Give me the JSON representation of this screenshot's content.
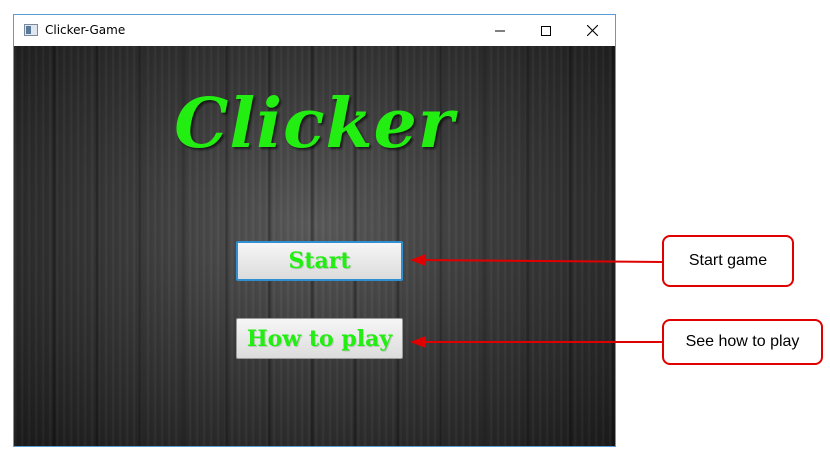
{
  "window": {
    "title": "Clicker-Game",
    "controls": {
      "minimize": "—",
      "maximize": "☐",
      "close": "✕"
    }
  },
  "game": {
    "logo": "Clicker",
    "start_label": "Start",
    "how_to_play_label": "How to play"
  },
  "annotations": {
    "start_callout": "Start game",
    "how_callout": "See how to play"
  },
  "colors": {
    "accent_green": "#22ee11",
    "annotation_red": "#e00000",
    "focus_blue": "#2f8fd0"
  }
}
